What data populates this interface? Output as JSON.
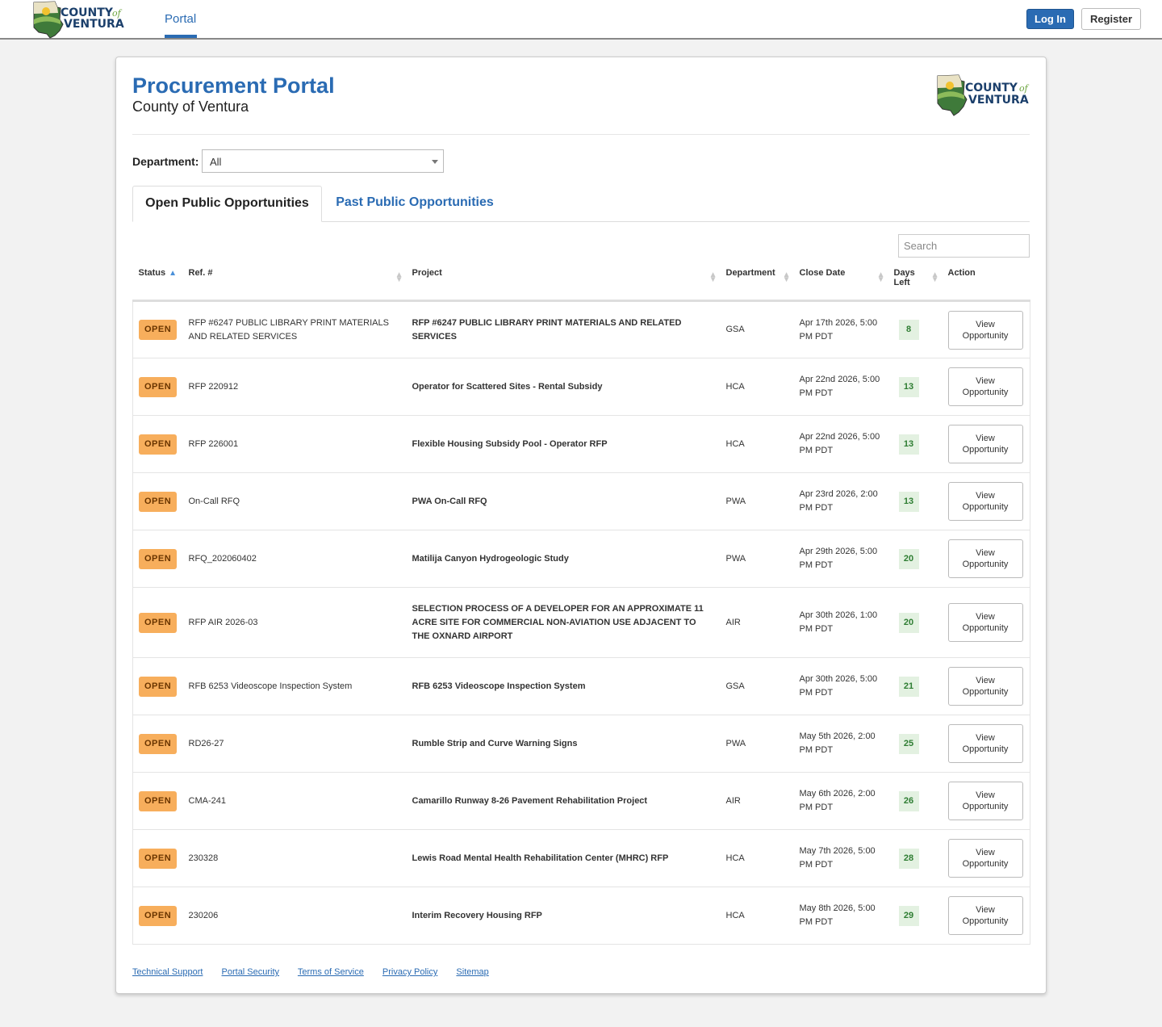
{
  "nav": {
    "tab_portal": "Portal",
    "login": "Log In",
    "register": "Register"
  },
  "logo": {
    "line1": "COUNTY",
    "of": "of",
    "line2": "VENTURA"
  },
  "header": {
    "title": "Procurement Portal",
    "subtitle": "County of Ventura"
  },
  "filter": {
    "label": "Department:",
    "selected": "All"
  },
  "tabs": {
    "open": "Open Public Opportunities",
    "past": "Past Public Opportunities"
  },
  "search": {
    "placeholder": "Search"
  },
  "table": {
    "columns": [
      "Status",
      "Ref. #",
      "Project",
      "Department",
      "Close Date",
      "Days Left",
      "Action"
    ],
    "rows": [
      {
        "status": "OPEN",
        "ref": "RFP #6247 PUBLIC LIBRARY PRINT MATERIALS AND RELATED SERVICES",
        "project": "RFP #6247 PUBLIC LIBRARY PRINT MATERIALS AND RELATED SERVICES",
        "department": "GSA",
        "close": "Apr 17th 2026, 5:00 PM PDT",
        "days": "8",
        "action": "View Opportunity"
      },
      {
        "status": "OPEN",
        "ref": "RFP 220912",
        "project": "Operator for Scattered Sites - Rental Subsidy",
        "department": "HCA",
        "close": "Apr 22nd 2026, 5:00 PM PDT",
        "days": "13",
        "action": "View Opportunity"
      },
      {
        "status": "OPEN",
        "ref": "RFP 226001",
        "project": "Flexible Housing Subsidy Pool - Operator RFP",
        "department": "HCA",
        "close": "Apr 22nd 2026, 5:00 PM PDT",
        "days": "13",
        "action": "View Opportunity"
      },
      {
        "status": "OPEN",
        "ref": "On-Call RFQ",
        "project": "PWA On-Call RFQ",
        "department": "PWA",
        "close": "Apr 23rd 2026, 2:00 PM PDT",
        "days": "13",
        "action": "View Opportunity"
      },
      {
        "status": "OPEN",
        "ref": "RFQ_202060402",
        "project": "Matilija Canyon Hydrogeologic Study",
        "department": "PWA",
        "close": "Apr 29th 2026, 5:00 PM PDT",
        "days": "20",
        "action": "View Opportunity"
      },
      {
        "status": "OPEN",
        "ref": "RFP AIR 2026-03",
        "project": "SELECTION PROCESS OF A DEVELOPER FOR AN APPROXIMATE 11 ACRE SITE FOR COMMERCIAL NON-AVIATION USE ADJACENT TO THE OXNARD AIRPORT",
        "department": "AIR",
        "close": "Apr 30th 2026, 1:00 PM PDT",
        "days": "20",
        "action": "View Opportunity"
      },
      {
        "status": "OPEN",
        "ref": "RFB 6253 Videoscope Inspection System",
        "project": "RFB 6253 Videoscope Inspection System",
        "department": "GSA",
        "close": "Apr 30th 2026, 5:00 PM PDT",
        "days": "21",
        "action": "View Opportunity"
      },
      {
        "status": "OPEN",
        "ref": "RD26-27",
        "project": "Rumble Strip and Curve Warning Signs",
        "department": "PWA",
        "close": "May 5th 2026, 2:00 PM PDT",
        "days": "25",
        "action": "View Opportunity"
      },
      {
        "status": "OPEN",
        "ref": "CMA-241",
        "project": "Camarillo Runway 8-26 Pavement Rehabilitation Project",
        "department": "AIR",
        "close": "May 6th 2026, 2:00 PM PDT",
        "days": "26",
        "action": "View Opportunity"
      },
      {
        "status": "OPEN",
        "ref": "230328",
        "project": "Lewis Road Mental Health Rehabilitation Center (MHRC) RFP",
        "department": "HCA",
        "close": "May 7th 2026, 5:00 PM PDT",
        "days": "28",
        "action": "View Opportunity"
      },
      {
        "status": "OPEN",
        "ref": "230206",
        "project": "Interim Recovery Housing RFP",
        "department": "HCA",
        "close": "May 8th 2026, 5:00 PM PDT",
        "days": "29",
        "action": "View Opportunity"
      }
    ]
  },
  "footer": {
    "links": [
      "Technical Support",
      "Portal Security",
      "Terms of Service",
      "Privacy Policy",
      "Sitemap"
    ]
  },
  "colors": {
    "brand": "#2a6bb3",
    "open_badge": "#f7ae5c",
    "days_badge_bg": "#e3f1e1",
    "days_badge_text": "#2e7d32"
  }
}
